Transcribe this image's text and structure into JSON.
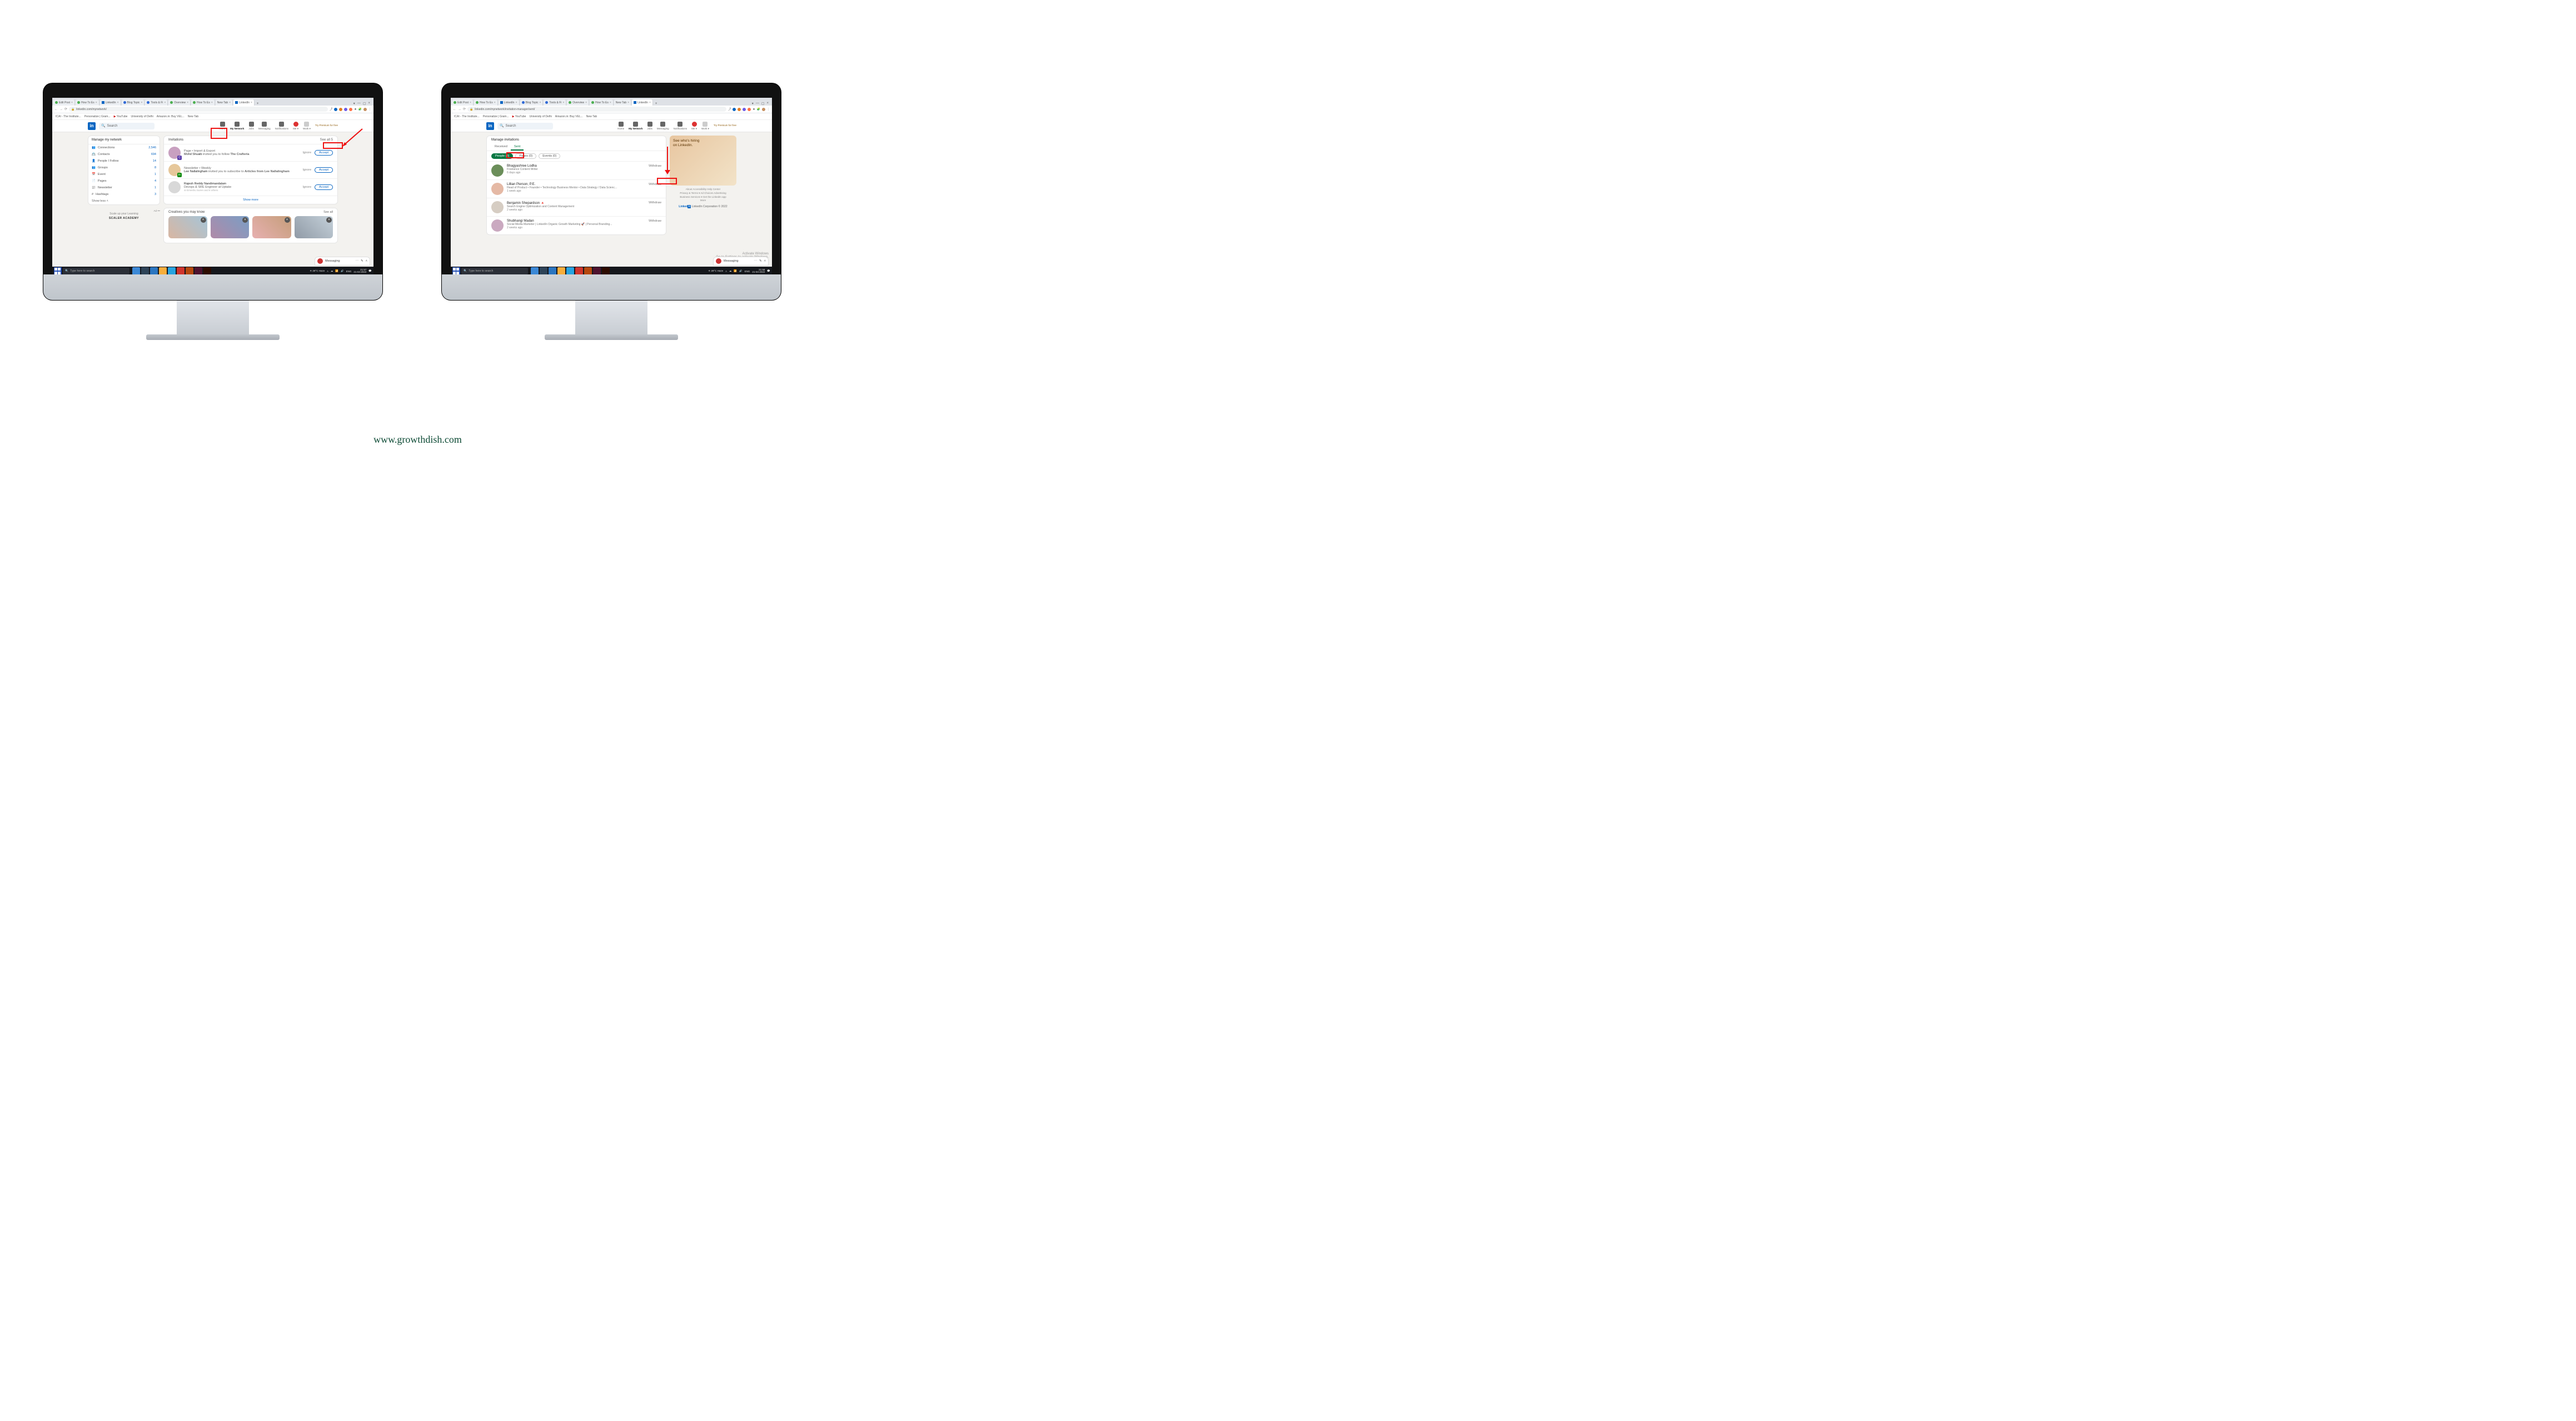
{
  "caption": "www.growthdish.com",
  "browser": {
    "tabs": [
      {
        "label": "Edit Post"
      },
      {
        "label": "How To Es"
      },
      {
        "label": "LinkedIn"
      },
      {
        "label": "Blog Topic"
      },
      {
        "label": "Tools & Fi"
      },
      {
        "label": "Overview"
      },
      {
        "label": "How To Es"
      },
      {
        "label": "New Tab"
      },
      {
        "label": "LinkedIn"
      }
    ],
    "url_left": "linkedin.com/mynetwork/",
    "url_right": "linkedin.com/mynetwork/invitation-manager/sent/",
    "bookmarks": [
      "ICAI - The Institute...",
      "Personalize | Gram...",
      "YouTube",
      "University of Delhi",
      "Amazon.in: Buy VEL...",
      "New Tab"
    ]
  },
  "linkedin_header": {
    "search_placeholder": "Search",
    "nav": [
      "Home",
      "My Network",
      "Jobs",
      "Messaging",
      "Notifications",
      "Me",
      "Work"
    ],
    "premium": "Try Premium for free"
  },
  "left": {
    "sidebar_title": "Manage my network",
    "sidebar_items": [
      {
        "label": "Connections",
        "count": "2,546"
      },
      {
        "label": "Contacts",
        "count": "694"
      },
      {
        "label": "People I Follow",
        "count": "14"
      },
      {
        "label": "Groups",
        "count": "8"
      },
      {
        "label": "Event",
        "count": "1"
      },
      {
        "label": "Pages",
        "count": "4"
      },
      {
        "label": "Newsletter",
        "count": "1"
      },
      {
        "label": "Hashtags",
        "count": "3"
      }
    ],
    "show_less": "Show less",
    "promo_text": "Scale up your Learning",
    "promo_brand": "SCALER ACADEMY",
    "ad_tag": "Ad •••",
    "invitations_title": "Invitations",
    "see_all": "See all 5",
    "invitations": [
      {
        "overline": "Page • Import & Export",
        "name": "Mohd Shuaib",
        "rest": "invited you to follow",
        "target": "The Crafteria",
        "badge": "C"
      },
      {
        "overline": "Newsletter • Weekly",
        "name": "Lee Nallalingham",
        "rest": "invited you to subscribe to",
        "target": "Articles from Lee Nallalingham",
        "badge": "in"
      },
      {
        "overline": "",
        "name": "Rajesh Reddy Nandimandalam",
        "rest": "Devops & SRE Engineer at Uptake",
        "target": "",
        "badge": ""
      }
    ],
    "mutual": "Erneshu Suren and 8 others",
    "ignore": "Ignore",
    "accept": "Accept",
    "show_more": "Show more",
    "creatives_title": "Creatives you may know",
    "creatives_see_all": "See all"
  },
  "right": {
    "title": "Manage invitations",
    "tabs": {
      "received": "Received",
      "sent": "Sent"
    },
    "filters": {
      "people": "People (8)",
      "pages": "Pages (0)",
      "events": "Events (0)"
    },
    "sent": [
      {
        "name": "Bhagyashree Lodha",
        "desc": "Freelance Content Writer",
        "time": "6 days ago"
      },
      {
        "name": "Lillian Pierson, P.E.",
        "desc": "Head of Product • Founder • Technology Business Mentor • Data Strategy / Data Scienc...",
        "time": "1 week ago"
      },
      {
        "name": "Benjamin Shepardson 🔺",
        "desc": "Search Engine Optimization and Content Management",
        "time": "2 weeks ago"
      },
      {
        "name": "Shubhangi Madan",
        "desc": "Social Media Marketer | LinkedIn Organic Growth Marketing 🚀 | Personal Branding...",
        "time": "2 weeks ago"
      }
    ],
    "withdraw": "Withdraw",
    "ad_title": "See who's hiring on LinkedIn.",
    "footer": "About  Accessibility  Help Center\n Privacy & Terms ▾  Ad Choices  Advertising\n Business Services ▾  Get the LinkedIn app\n More",
    "copyright": "LinkedIn Corporation © 2022",
    "watermark": "Activate Windows\nGo to Settings to activate Windows."
  },
  "dock": {
    "label": "Messaging"
  },
  "windows": {
    "search_placeholder": "Type here to search",
    "weather": "29°C Haze",
    "time_left": "21:57\n21-04-2022",
    "time_right": "21:58\n21-04-2022",
    "lang": "ENG"
  }
}
